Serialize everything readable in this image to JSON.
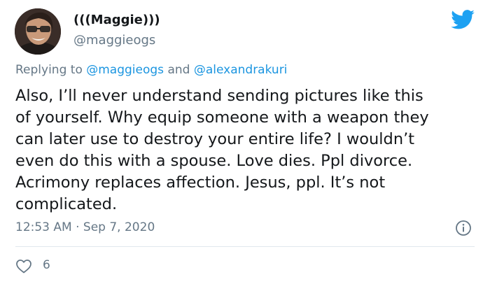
{
  "author": {
    "display_name": "(((Maggie)))",
    "handle": "@maggieogs"
  },
  "reply": {
    "prefix": "Replying to",
    "mention_1": "@maggieogs",
    "connector": "and",
    "mention_2": "@alexandrakuri"
  },
  "tweet": {
    "text": "Also, I’ll never understand sending pictures like this\nof yourself. Why equip someone with a weapon they\ncan later use to destroy your entire life? I wouldn’t\neven do this with a spouse. Love dies. Ppl divorce.\nAcrimony replaces affection. Jesus, ppl. It’s not\ncomplicated.",
    "time": "12:53 AM",
    "separator": "·",
    "date": "Sep 7, 2020"
  },
  "actions": {
    "like_count": "6"
  },
  "colors": {
    "brand": "#1da1f2",
    "mention": "#1b95e0",
    "secondary_text": "#657786",
    "divider": "#e1e8ed"
  },
  "icons": {
    "brand": "twitter-bird-icon",
    "info": "info-icon",
    "like": "heart-icon"
  }
}
